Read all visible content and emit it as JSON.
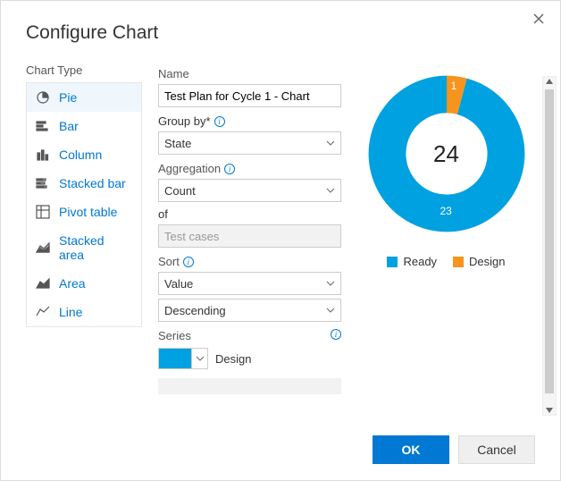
{
  "dialog": {
    "title": "Configure Chart",
    "chart_type_label": "Chart Type",
    "types": [
      {
        "key": "pie",
        "label": "Pie",
        "selected": true
      },
      {
        "key": "bar",
        "label": "Bar",
        "selected": false
      },
      {
        "key": "column",
        "label": "Column",
        "selected": false
      },
      {
        "key": "stacked-bar",
        "label": "Stacked bar",
        "selected": false
      },
      {
        "key": "pivot-table",
        "label": "Pivot table",
        "selected": false
      },
      {
        "key": "stacked-area",
        "label": "Stacked area",
        "selected": false
      },
      {
        "key": "area",
        "label": "Area",
        "selected": false
      },
      {
        "key": "line",
        "label": "Line",
        "selected": false
      }
    ],
    "form": {
      "name_label": "Name",
      "name_value": "Test Plan for Cycle 1 - Chart",
      "group_by_label": "Group by*",
      "group_by_value": "State",
      "aggregation_label": "Aggregation",
      "aggregation_value": "Count",
      "of_label": "of",
      "of_value": "Test cases",
      "sort_label": "Sort",
      "sort_field": "Value",
      "sort_direction": "Descending",
      "series_label": "Series",
      "series_color": "#00a1e0",
      "series_name": "Design"
    },
    "buttons": {
      "ok": "OK",
      "cancel": "Cancel"
    }
  },
  "chart_data": {
    "type": "pie",
    "variant": "donut",
    "total": 24,
    "categories": [
      "Ready",
      "Design"
    ],
    "values": [
      23,
      1
    ],
    "colors": [
      "#00a1e0",
      "#f7941e"
    ],
    "legend": [
      "Ready",
      "Design"
    ],
    "center_label": "24"
  }
}
